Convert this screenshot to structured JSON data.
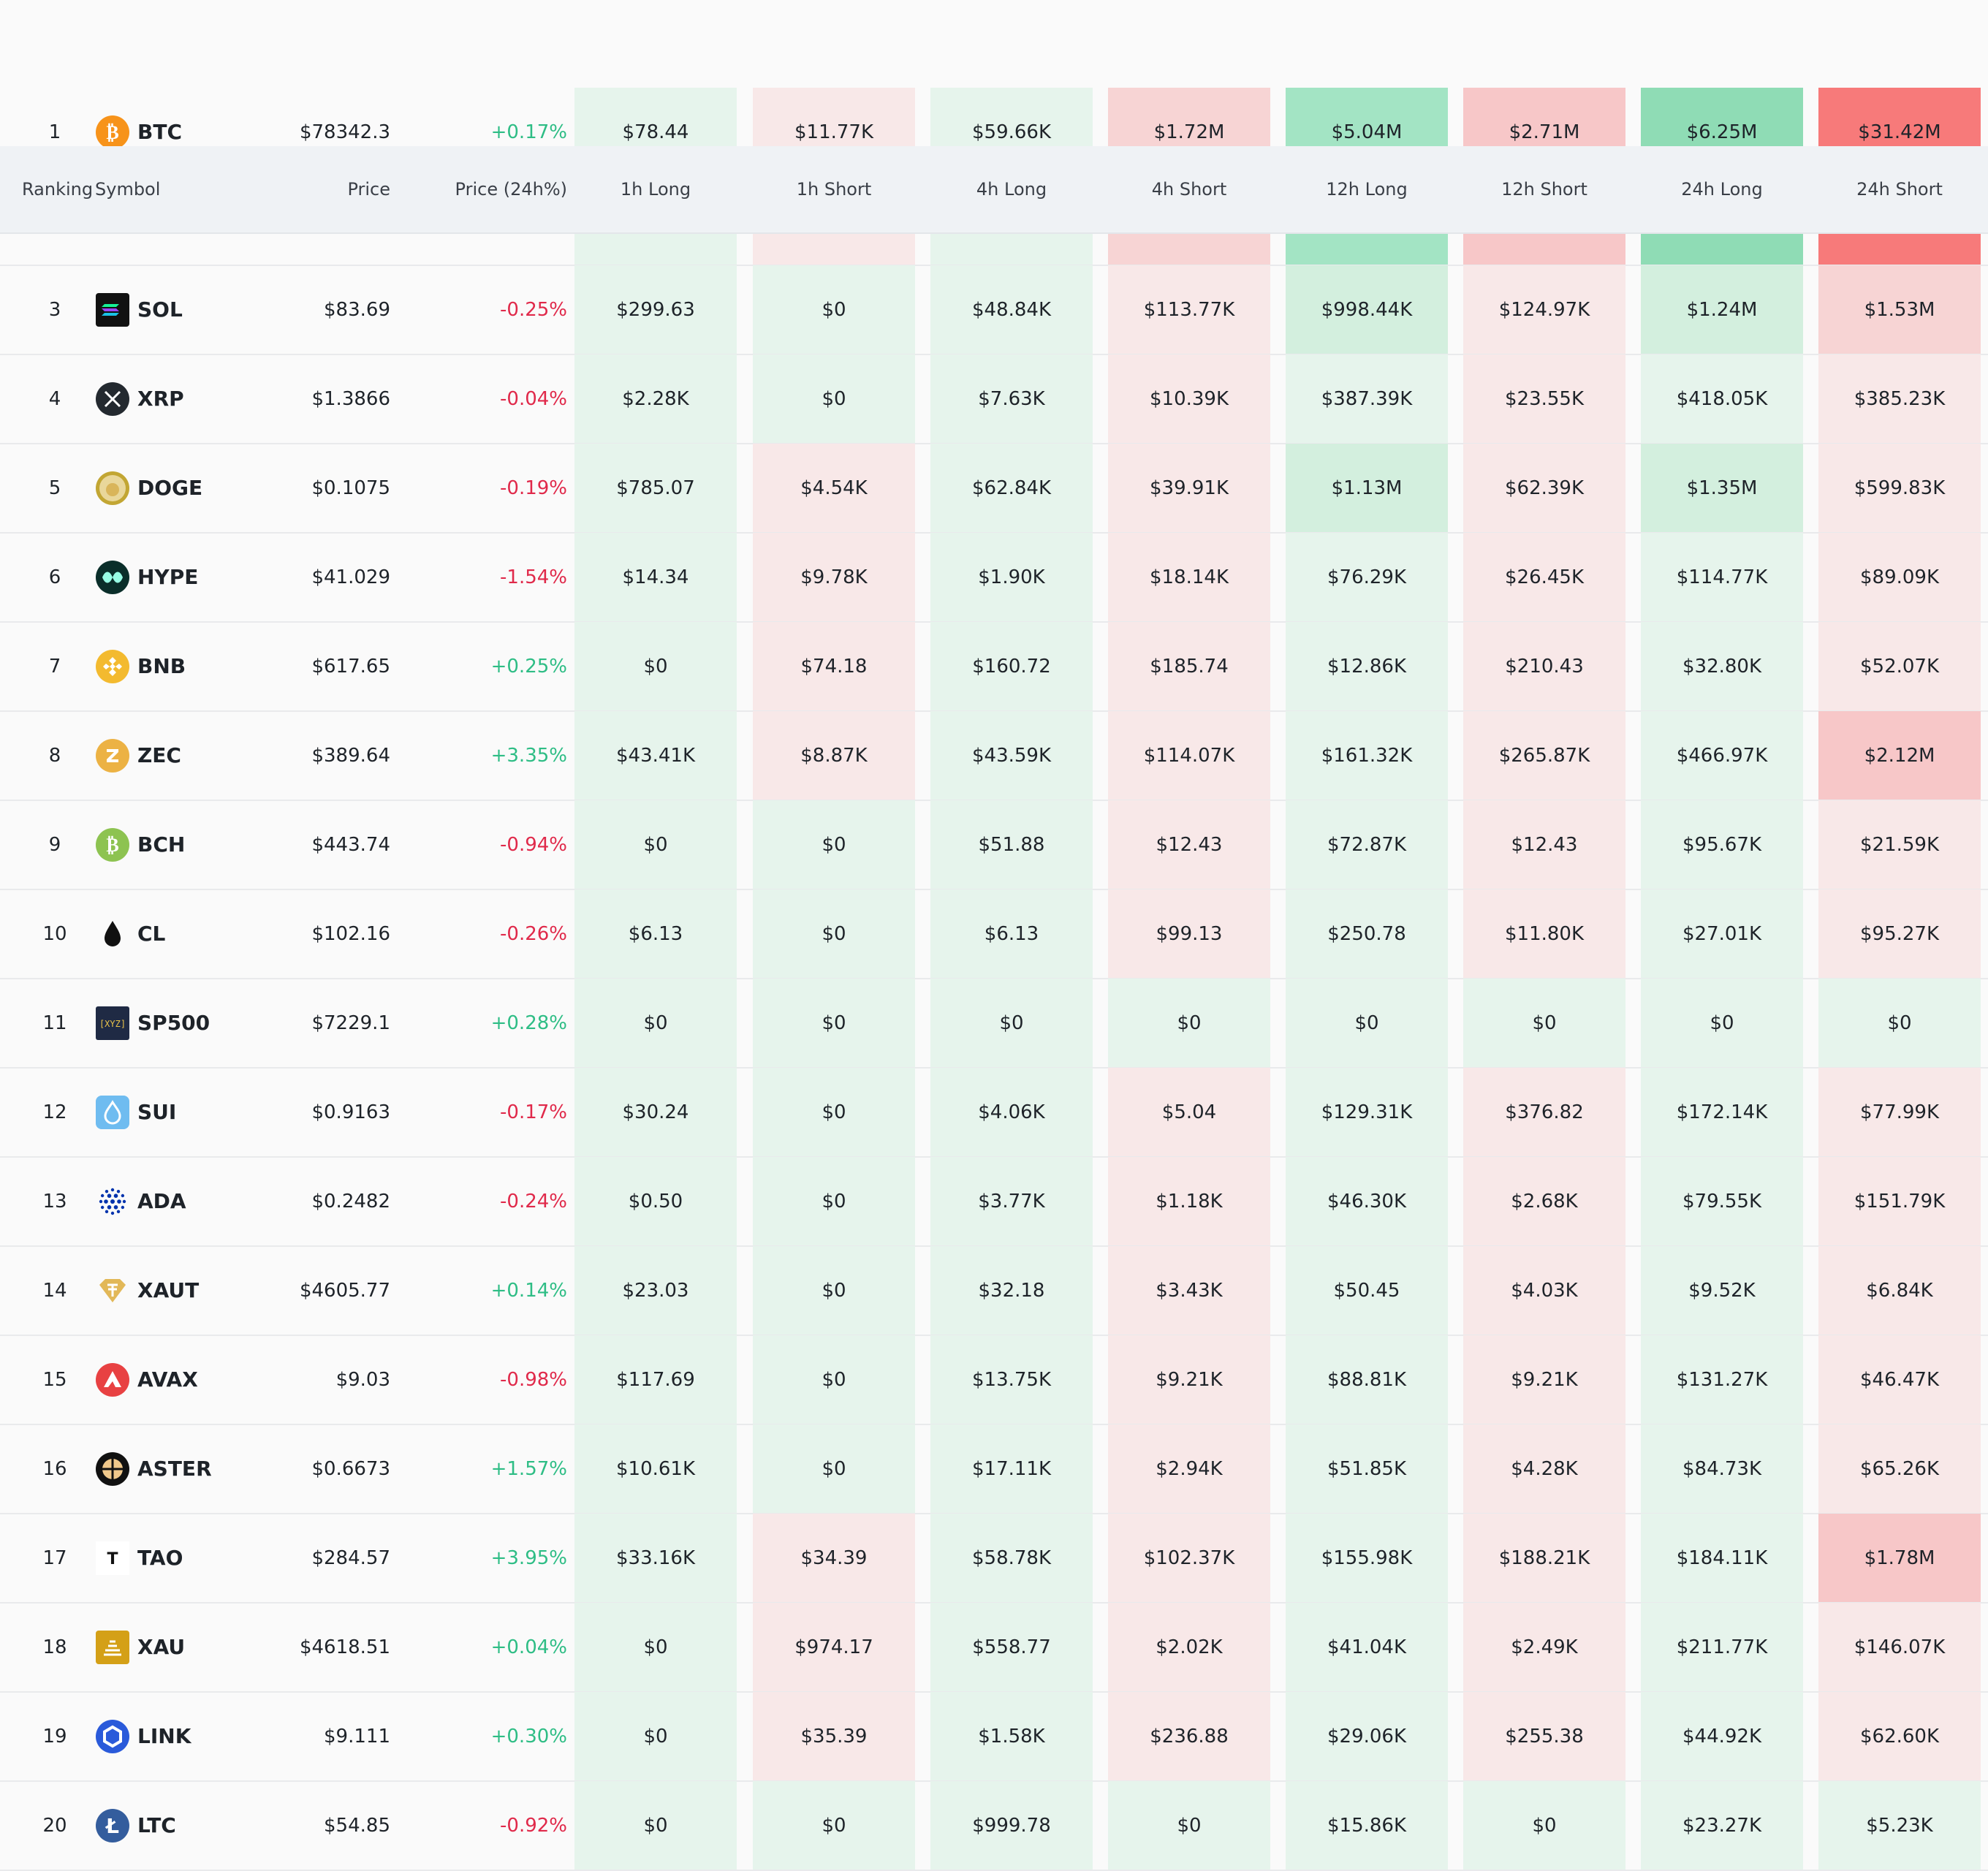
{
  "columns": {
    "ranking": "Ranking",
    "symbol": "Symbol",
    "price": "Price",
    "change": "Price (24h%)",
    "h1_long": "1h Long",
    "h1_short": "1h Short",
    "h4_long": "4h Long",
    "h4_short": "4h Short",
    "h12_long": "12h Long",
    "h12_short": "12h Short",
    "h24_long": "24h Long",
    "h24_short": "24h Short"
  },
  "colors": {
    "long_light": "#e6f4ec",
    "long_mid": "#d3efde",
    "long_strong": "#a3e4c4",
    "long_stronger": "#8fdcb5",
    "short_light": "#f8e8e8",
    "short_mid": "#f7d4d4",
    "short_strong": "#f7c7c8",
    "short_strongest": "#f77a7a",
    "positive": "#2ebd85",
    "negative": "#e0294a"
  },
  "rows": [
    {
      "rank": "1",
      "symbol": "BTC",
      "icon": "bitcoin-icon",
      "price": "$78342.3",
      "change": "+0.17%",
      "values": [
        "$78.44",
        "$11.77K",
        "$59.66K",
        "$1.72M",
        "$5.04M",
        "$2.71M",
        "$6.25M",
        "$31.42M"
      ]
    },
    {
      "rank": "3",
      "symbol": "SOL",
      "icon": "solana-icon",
      "price": "$83.69",
      "change": "-0.25%",
      "values": [
        "$299.63",
        "$0",
        "$48.84K",
        "$113.77K",
        "$998.44K",
        "$124.97K",
        "$1.24M",
        "$1.53M"
      ]
    },
    {
      "rank": "4",
      "symbol": "XRP",
      "icon": "xrp-icon",
      "price": "$1.3866",
      "change": "-0.04%",
      "values": [
        "$2.28K",
        "$0",
        "$7.63K",
        "$10.39K",
        "$387.39K",
        "$23.55K",
        "$418.05K",
        "$385.23K"
      ]
    },
    {
      "rank": "5",
      "symbol": "DOGE",
      "icon": "doge-icon",
      "price": "$0.1075",
      "change": "-0.19%",
      "values": [
        "$785.07",
        "$4.54K",
        "$62.84K",
        "$39.91K",
        "$1.13M",
        "$62.39K",
        "$1.35M",
        "$599.83K"
      ]
    },
    {
      "rank": "6",
      "symbol": "HYPE",
      "icon": "hype-icon",
      "price": "$41.029",
      "change": "-1.54%",
      "values": [
        "$14.34",
        "$9.78K",
        "$1.90K",
        "$18.14K",
        "$76.29K",
        "$26.45K",
        "$114.77K",
        "$89.09K"
      ]
    },
    {
      "rank": "7",
      "symbol": "BNB",
      "icon": "bnb-icon",
      "price": "$617.65",
      "change": "+0.25%",
      "values": [
        "$0",
        "$74.18",
        "$160.72",
        "$185.74",
        "$12.86K",
        "$210.43",
        "$32.80K",
        "$52.07K"
      ]
    },
    {
      "rank": "8",
      "symbol": "ZEC",
      "icon": "zcash-icon",
      "price": "$389.64",
      "change": "+3.35%",
      "values": [
        "$43.41K",
        "$8.87K",
        "$43.59K",
        "$114.07K",
        "$161.32K",
        "$265.87K",
        "$466.97K",
        "$2.12M"
      ]
    },
    {
      "rank": "9",
      "symbol": "BCH",
      "icon": "bitcoin-cash-icon",
      "price": "$443.74",
      "change": "-0.94%",
      "values": [
        "$0",
        "$0",
        "$51.88",
        "$12.43",
        "$72.87K",
        "$12.43",
        "$95.67K",
        "$21.59K"
      ]
    },
    {
      "rank": "10",
      "symbol": "CL",
      "icon": "oil-drop-icon",
      "price": "$102.16",
      "change": "-0.26%",
      "values": [
        "$6.13",
        "$0",
        "$6.13",
        "$99.13",
        "$250.78",
        "$11.80K",
        "$27.01K",
        "$95.27K"
      ]
    },
    {
      "rank": "11",
      "symbol": "SP500",
      "icon": "xyz-icon",
      "icon_text": "[XYZ]",
      "price": "$7229.1",
      "change": "+0.28%",
      "values": [
        "$0",
        "$0",
        "$0",
        "$0",
        "$0",
        "$0",
        "$0",
        "$0"
      ]
    },
    {
      "rank": "12",
      "symbol": "SUI",
      "icon": "sui-icon",
      "price": "$0.9163",
      "change": "-0.17%",
      "values": [
        "$30.24",
        "$0",
        "$4.06K",
        "$5.04",
        "$129.31K",
        "$376.82",
        "$172.14K",
        "$77.99K"
      ]
    },
    {
      "rank": "13",
      "symbol": "ADA",
      "icon": "cardano-icon",
      "price": "$0.2482",
      "change": "-0.24%",
      "values": [
        "$0.50",
        "$0",
        "$3.77K",
        "$1.18K",
        "$46.30K",
        "$2.68K",
        "$79.55K",
        "$151.79K"
      ]
    },
    {
      "rank": "14",
      "symbol": "XAUT",
      "icon": "tether-gold-icon",
      "price": "$4605.77",
      "change": "+0.14%",
      "values": [
        "$23.03",
        "$0",
        "$32.18",
        "$3.43K",
        "$50.45",
        "$4.03K",
        "$9.52K",
        "$6.84K"
      ]
    },
    {
      "rank": "15",
      "symbol": "AVAX",
      "icon": "avalanche-icon",
      "price": "$9.03",
      "change": "-0.98%",
      "values": [
        "$117.69",
        "$0",
        "$13.75K",
        "$9.21K",
        "$88.81K",
        "$9.21K",
        "$131.27K",
        "$46.47K"
      ]
    },
    {
      "rank": "16",
      "symbol": "ASTER",
      "icon": "aster-icon",
      "price": "$0.6673",
      "change": "+1.57%",
      "values": [
        "$10.61K",
        "$0",
        "$17.11K",
        "$2.94K",
        "$51.85K",
        "$4.28K",
        "$84.73K",
        "$65.26K"
      ]
    },
    {
      "rank": "17",
      "symbol": "TAO",
      "icon": "tao-icon",
      "icon_text": "T",
      "price": "$284.57",
      "change": "+3.95%",
      "values": [
        "$33.16K",
        "$34.39",
        "$58.78K",
        "$102.37K",
        "$155.98K",
        "$188.21K",
        "$184.11K",
        "$1.78M"
      ]
    },
    {
      "rank": "18",
      "symbol": "XAU",
      "icon": "gold-bars-icon",
      "price": "$4618.51",
      "change": "+0.04%",
      "values": [
        "$0",
        "$974.17",
        "$558.77",
        "$2.02K",
        "$41.04K",
        "$2.49K",
        "$211.77K",
        "$146.07K"
      ]
    },
    {
      "rank": "19",
      "symbol": "LINK",
      "icon": "chainlink-icon",
      "price": "$9.111",
      "change": "+0.30%",
      "values": [
        "$0",
        "$35.39",
        "$1.58K",
        "$236.88",
        "$29.06K",
        "$255.38",
        "$44.92K",
        "$62.60K"
      ]
    },
    {
      "rank": "20",
      "symbol": "LTC",
      "icon": "litecoin-icon",
      "price": "$54.85",
      "change": "-0.92%",
      "values": [
        "$0",
        "$0",
        "$999.78",
        "$0",
        "$15.86K",
        "$0",
        "$23.27K",
        "$5.23K"
      ]
    }
  ]
}
